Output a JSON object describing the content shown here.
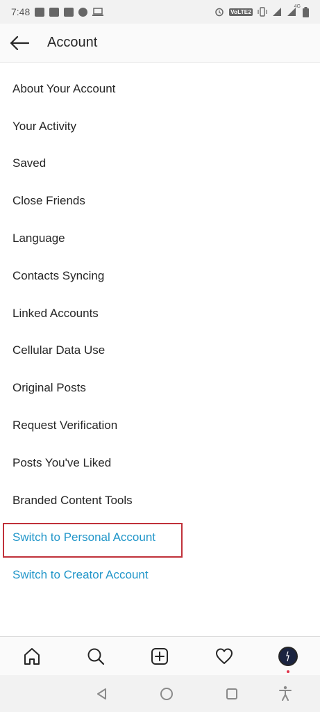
{
  "status_bar": {
    "time": "7:48",
    "network_label": "VoLTE2",
    "signal_label": "4G"
  },
  "header": {
    "title": "Account"
  },
  "menu": {
    "items": [
      {
        "label": "About Your Account"
      },
      {
        "label": "Your Activity"
      },
      {
        "label": "Saved"
      },
      {
        "label": "Close Friends"
      },
      {
        "label": "Language"
      },
      {
        "label": "Contacts Syncing"
      },
      {
        "label": "Linked Accounts"
      },
      {
        "label": "Cellular Data Use"
      },
      {
        "label": "Original Posts"
      },
      {
        "label": "Request Verification"
      },
      {
        "label": "Posts You've Liked"
      },
      {
        "label": "Branded Content Tools"
      },
      {
        "label": "Switch to Personal Account"
      },
      {
        "label": "Switch to Creator Account"
      }
    ]
  },
  "bottom_nav": {
    "icons": [
      "home-icon",
      "search-icon",
      "new-post-icon",
      "activity-heart-icon",
      "profile-avatar"
    ]
  },
  "colors": {
    "link": "#2196c9",
    "highlight_border": "#c0313a",
    "text": "#262626"
  }
}
